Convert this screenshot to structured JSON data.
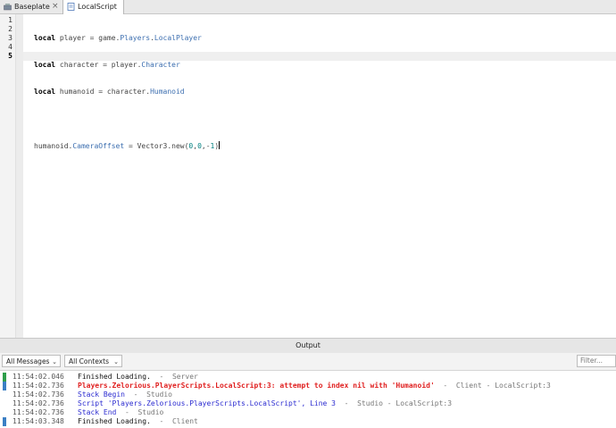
{
  "tabs": [
    {
      "label": "Baseplate",
      "close": "×",
      "icon": "place-icon"
    },
    {
      "label": "LocalScript",
      "close": "",
      "icon": "script-icon"
    }
  ],
  "editor": {
    "line_numbers": [
      "1",
      "2",
      "3",
      "4",
      "5"
    ],
    "lines": [
      {
        "kw": "local",
        "rest1": " player = game.",
        "prop1": "Players",
        "rest2": ".",
        "prop2": "LocalPlayer"
      },
      {
        "kw": "local",
        "rest1": " character = player.",
        "prop1": "Character",
        "rest2": "",
        "prop2": ""
      },
      {
        "kw": "local",
        "rest1": " humanoid = character.",
        "prop1": "Humanoid",
        "rest2": "",
        "prop2": ""
      }
    ],
    "line5": {
      "a": "humanoid.",
      "prop": "CameraOffset",
      "b": " = Vector3.new(",
      "n1": "0",
      "c1": ",",
      "n2": "0",
      "c2": ",-",
      "n3": "1",
      "end": ")"
    }
  },
  "output": {
    "title": "Output",
    "messages_filter": "All Messages",
    "contexts_filter": "All Contexts",
    "filter_placeholder": "Filter...",
    "rows": [
      {
        "marker": "#2e9e4a",
        "time": "11:54:02.046",
        "text": "Finished Loading.",
        "suffix": "  -  Server",
        "style": "black"
      },
      {
        "marker": "#3b7fc4",
        "time": "11:54:02.736",
        "text": "Players.Zelorious.PlayerScripts.LocalScript:3: attempt to index nil with 'Humanoid'",
        "suffix": "  -  Client - LocalScript:3",
        "style": "red"
      },
      {
        "marker": "",
        "time": "11:54:02.736",
        "text": "Stack Begin",
        "suffix": "  -  Studio",
        "style": "blue"
      },
      {
        "marker": "",
        "time": "11:54:02.736",
        "text": "Script 'Players.Zelorious.PlayerScripts.LocalScript', Line 3",
        "suffix": "  -  Studio - LocalScript:3",
        "style": "blue"
      },
      {
        "marker": "",
        "time": "11:54:02.736",
        "text": "Stack End",
        "suffix": "  -  Studio",
        "style": "blue"
      },
      {
        "marker": "#3b7fc4",
        "time": "11:54:03.348",
        "text": "Finished Loading.",
        "suffix": "  -  Client",
        "style": "black"
      }
    ]
  },
  "colors": {
    "keyword": "#000000",
    "property": "#3d6fb0",
    "number": "#008080",
    "error": "#e02020",
    "info": "#2a2ad0"
  }
}
